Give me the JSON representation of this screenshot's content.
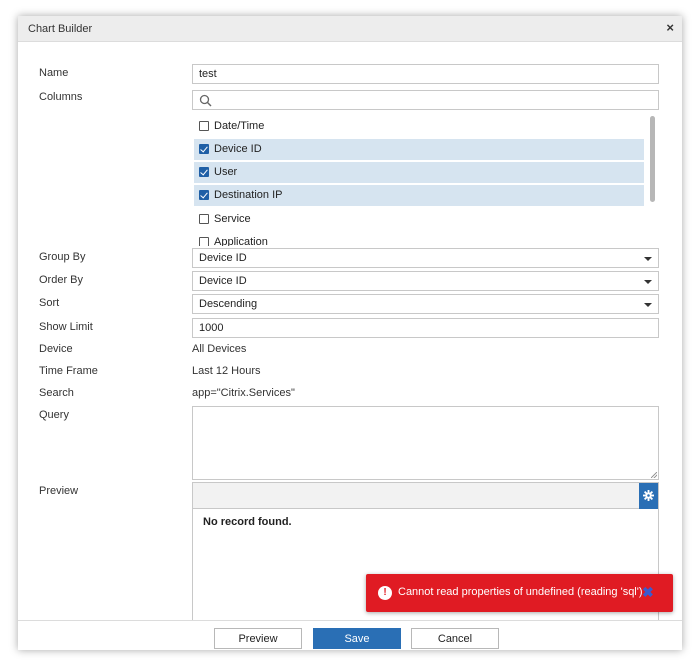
{
  "dialog": {
    "title": "Chart Builder",
    "close_glyph": "×"
  },
  "form": {
    "name_label": "Name",
    "name_value": "test",
    "columns_label": "Columns",
    "columns_search_value": "",
    "columns": [
      {
        "label": "Date/Time",
        "checked": false
      },
      {
        "label": "Device ID",
        "checked": true
      },
      {
        "label": "User",
        "checked": true
      },
      {
        "label": "Destination IP",
        "checked": true
      },
      {
        "label": "Service",
        "checked": false
      },
      {
        "label": "Application",
        "checked": false
      }
    ],
    "group_by_label": "Group By",
    "group_by_value": "Device ID",
    "order_by_label": "Order By",
    "order_by_value": "Device ID",
    "sort_label": "Sort",
    "sort_value": "Descending",
    "show_limit_label": "Show Limit",
    "show_limit_value": "1000",
    "device_label": "Device",
    "device_value": "All Devices",
    "time_frame_label": "Time Frame",
    "time_frame_value": "Last 12 Hours",
    "search_label": "Search",
    "search_value": "app=\"Citrix.Services\"",
    "query_label": "Query",
    "query_value": "",
    "preview_label": "Preview",
    "preview_empty": "No record found."
  },
  "footer": {
    "preview_button": "Preview",
    "save_button": "Save",
    "cancel_button": "Cancel"
  },
  "toast": {
    "icon_glyph": "!",
    "message": "Cannot read properties of undefined (reading 'sql')",
    "close_glyph": "✖"
  },
  "colors": {
    "primary": "#2a6fb5",
    "selected_row": "#d6e4f0",
    "error": "#e01b23"
  }
}
